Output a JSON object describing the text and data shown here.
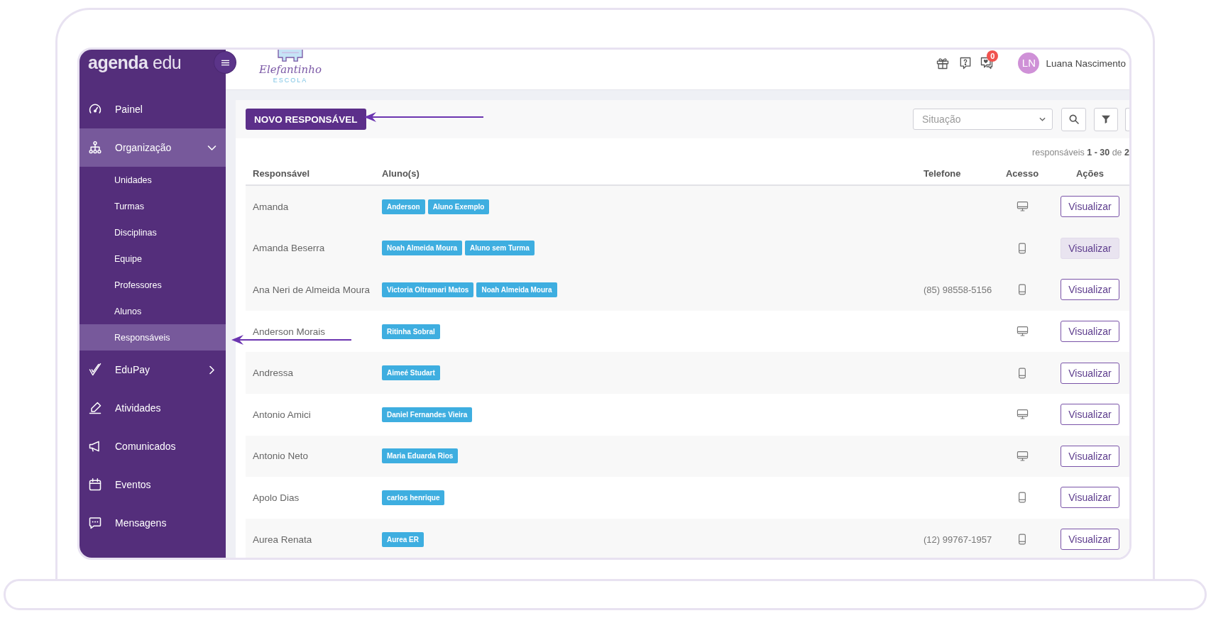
{
  "sidebar": {
    "logo": "**agenda** edu",
    "items": [
      {
        "label": "Painel",
        "selected": false
      },
      {
        "label": "Organização",
        "selected": true,
        "expanded": true,
        "children": [
          {
            "label": "Unidades",
            "selected": false
          },
          {
            "label": "Turmas",
            "selected": false
          },
          {
            "label": "Disciplinas",
            "selected": false
          },
          {
            "label": "Equipe",
            "selected": false
          },
          {
            "label": "Professores",
            "selected": false
          },
          {
            "label": "Alunos",
            "selected": false
          },
          {
            "label": "Responsáveis",
            "selected": true
          }
        ]
      },
      {
        "label": "EduPay",
        "selected": false,
        "expanded": false
      },
      {
        "label": "Atividades",
        "selected": false
      },
      {
        "label": "Comunicados",
        "selected": false
      },
      {
        "label": "Eventos",
        "selected": false
      },
      {
        "label": "Mensagens",
        "selected": false
      }
    ]
  },
  "header": {
    "school_logo": {
      "name": "Elefantinho",
      "tagline": "ESCOLA"
    },
    "notification_count": "0",
    "user": {
      "initials": "LN",
      "name": "Luana Nascimento"
    }
  },
  "toolbar": {
    "new_button": "NOVO RESPONSÁVEL",
    "status_select": {
      "placeholder": "Situação"
    }
  },
  "table": {
    "summary": "responsáveis **1 - 30** de **2**",
    "columns": [
      "Responsável",
      "Aluno(s)",
      "Telefone",
      "Acesso",
      "Ações"
    ],
    "rows": [
      {
        "name": "Amanda",
        "students": [
          "Anderson",
          "Aluno Exemplo"
        ],
        "access": {
          "kind": "desktop"
        },
        "action": "Visualizar",
        "hovered": false
      },
      {
        "name": "Amanda Beserra",
        "students": [
          "Noah Almeida Moura",
          "Aluno sem Turma"
        ],
        "access": {
          "kind": "mobile"
        },
        "action": "Visualizar",
        "hovered": true
      },
      {
        "name": "Ana Neri de Almeida Moura",
        "students": [
          "Victoria Oltramari Matos",
          "Noah Almeida Moura"
        ],
        "phone": "(85) 98558-5156",
        "access": {
          "kind": "mobile"
        },
        "action": "Visualizar",
        "hovered": false
      },
      {
        "name": "Anderson Morais",
        "students": [
          "Ritinha Sobral"
        ],
        "access": {
          "kind": "desktop"
        },
        "action": "Visualizar",
        "hovered": false
      },
      {
        "name": "Andressa",
        "students": [
          "Aimeé Studart"
        ],
        "access": {
          "kind": "mobile"
        },
        "action": "Visualizar",
        "hovered": false
      },
      {
        "name": "Antonio Amici",
        "students": [
          "Daniel Fernandes Vieira"
        ],
        "access": {
          "kind": "desktop"
        },
        "action": "Visualizar",
        "hovered": false
      },
      {
        "name": "Antonio Neto",
        "students": [
          "Maria Eduarda Rios"
        ],
        "access": {
          "kind": "desktop"
        },
        "action": "Visualizar",
        "hovered": false
      },
      {
        "name": "Apolo Dias",
        "students": [
          "carlos henrique"
        ],
        "access": {
          "kind": "mobile"
        },
        "action": "Visualizar",
        "hovered": false
      },
      {
        "name": "Aurea Renata",
        "students": [
          "Aurea ER"
        ],
        "phone": "(12) 99767-1957",
        "access": {
          "kind": "mobile"
        },
        "action": "Visualizar",
        "hovered": false
      }
    ]
  }
}
